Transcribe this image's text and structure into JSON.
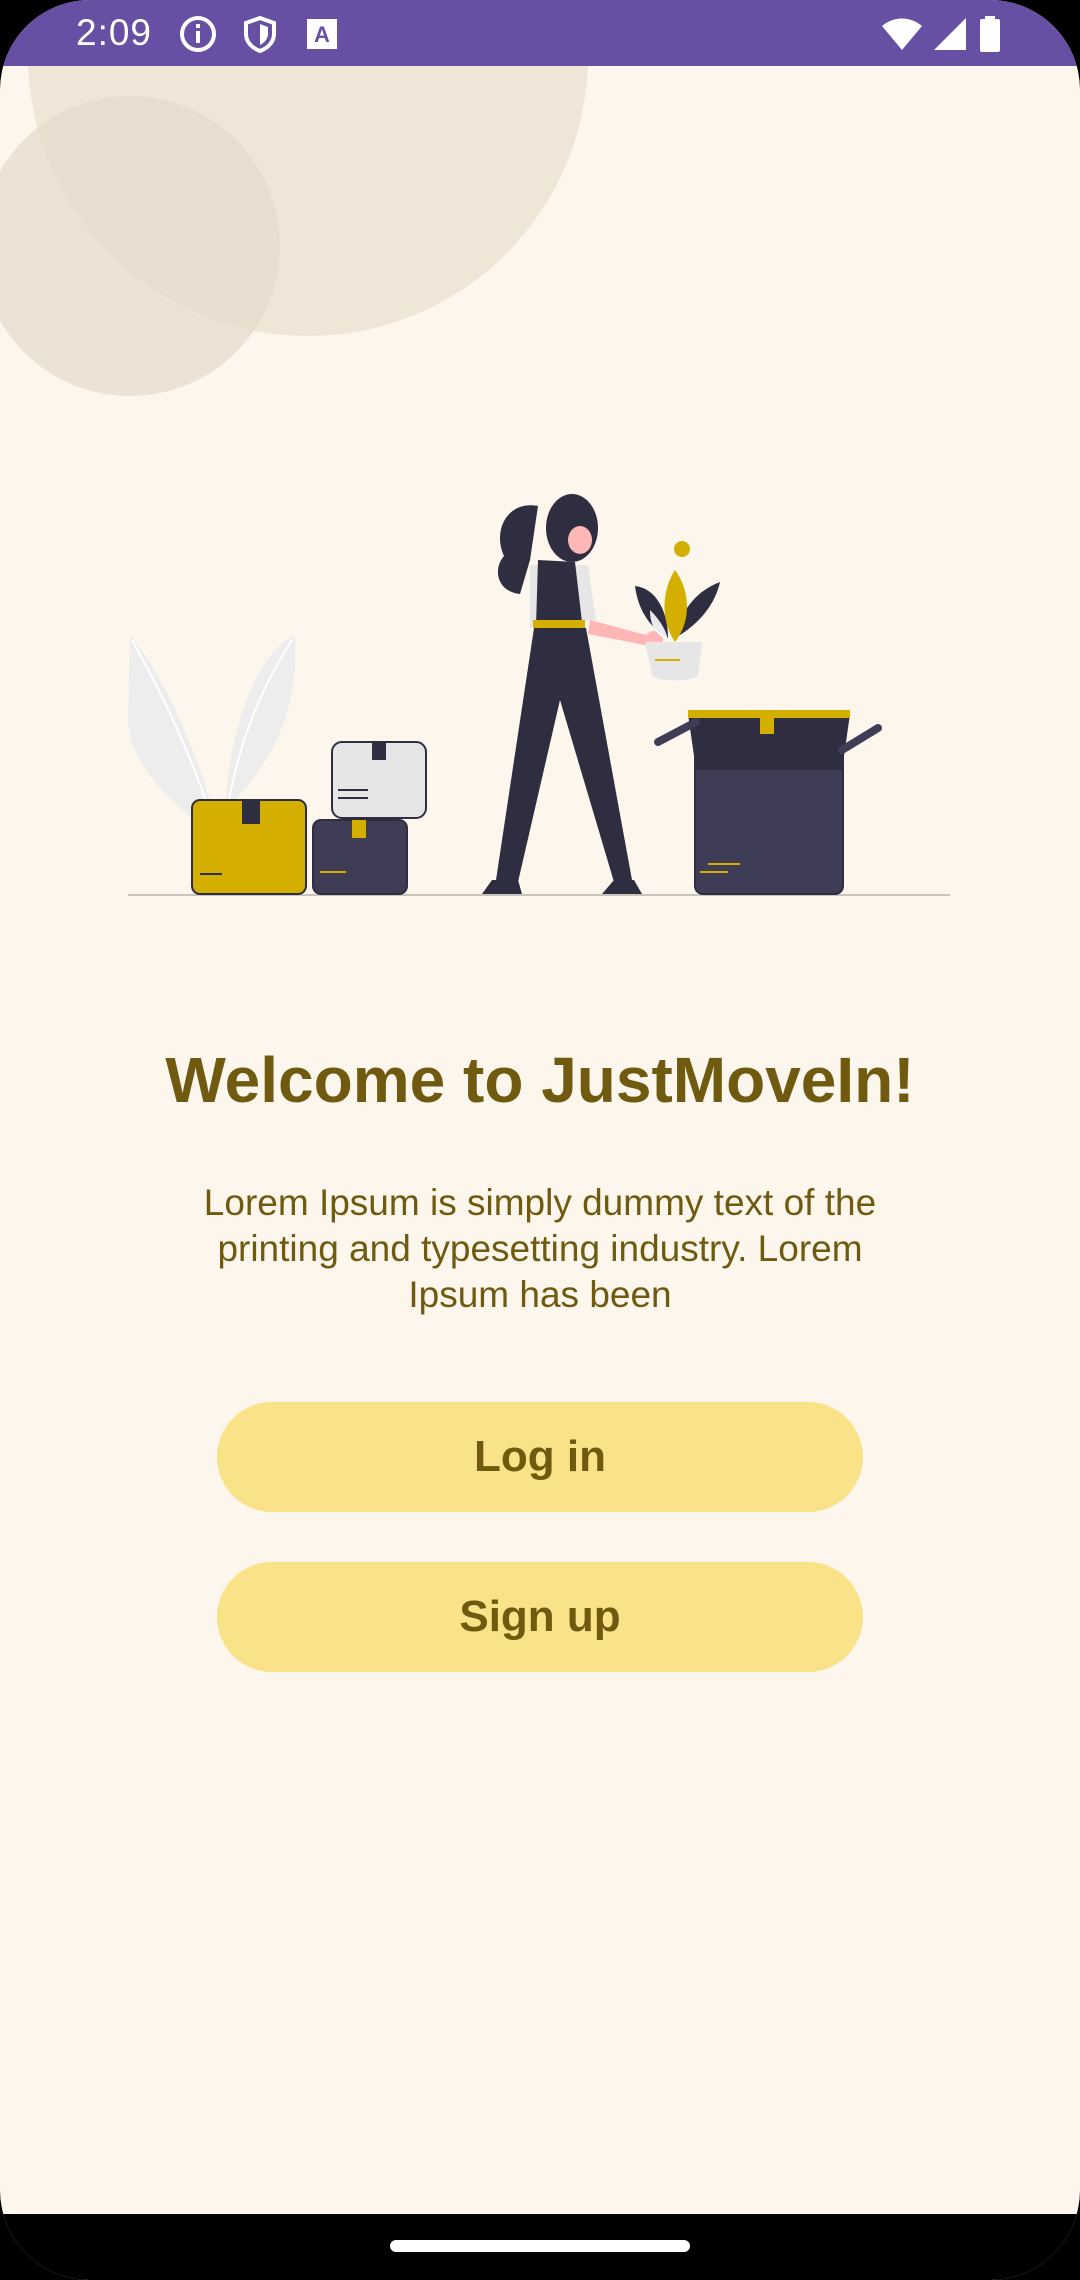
{
  "status_bar": {
    "time": "2:09",
    "left_icons": [
      "info-icon",
      "shield-icon",
      "keyboard-a-icon"
    ],
    "right_icons": [
      "wifi-icon",
      "signal-icon",
      "battery-icon"
    ],
    "color": "#6750A4"
  },
  "welcome": {
    "title": "Welcome to JustMoveIn!",
    "description": "Lorem Ipsum is simply dummy text of the printing and typesetting industry. Lorem Ipsum has been"
  },
  "actions": {
    "login_label": "Log in",
    "signup_label": "Sign up"
  },
  "colors": {
    "background": "#FDF6EC",
    "text_primary": "#6F5A10",
    "button_fill": "#F9E288",
    "accent_yellow": "#D4AF00",
    "dark_navy": "#2F2E41"
  }
}
